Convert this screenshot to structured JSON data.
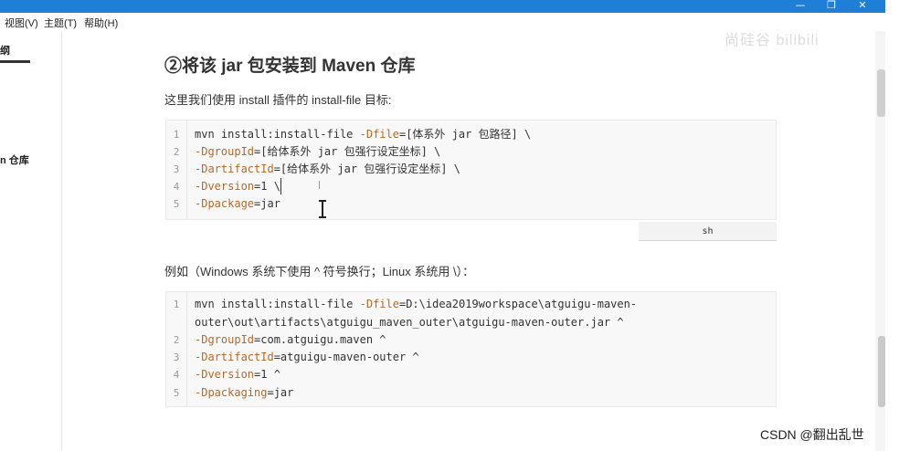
{
  "window": {
    "min_glyph": "—",
    "max_glyph": "❐",
    "close_glyph": "✕"
  },
  "menu": {
    "view": "视图(V)",
    "theme": "主题(T)",
    "help": "帮助(H)"
  },
  "sidebar": {
    "items": [
      {
        "label": "纲"
      },
      {
        "label": "n 仓库"
      }
    ]
  },
  "watermark": "尚硅谷 bilibili",
  "content": {
    "heading": "②将该 jar 包安装到 Maven 仓库",
    "intro": "这里我们使用 install 插件的 install-file 目标:",
    "example_intro": "例如（Windows 系统下使用 ^ 符号换行；Linux 系统用 \\）：",
    "code1": {
      "lang": "sh",
      "lines": [
        {
          "n": "1",
          "cmd": "mvn install:install-file ",
          "param": "-Dfile",
          "rest": "=[体系外 jar 包路径] \\"
        },
        {
          "n": "2",
          "cmd": "",
          "param": "-DgroupId",
          "rest": "=[给体系外 jar 包强行设定坐标] \\"
        },
        {
          "n": "3",
          "cmd": "",
          "param": "-DartifactId",
          "rest": "=[给体系外 jar 包强行设定坐标] \\"
        },
        {
          "n": "4",
          "cmd": "",
          "param": "-Dversion",
          "rest": "=1 \\"
        },
        {
          "n": "5",
          "cmd": "",
          "param": "-Dpackage",
          "rest": "=jar"
        }
      ]
    },
    "code2": {
      "lines": [
        {
          "n": "1",
          "cmd": "mvn install:install-file ",
          "param": "-Dfile",
          "rest": "=D:\\idea2019workspace\\atguigu-maven-"
        },
        {
          "n": "",
          "cmd": "outer\\out\\artifacts\\atguigu_maven_outer\\atguigu-maven-outer.jar ^",
          "param": "",
          "rest": ""
        },
        {
          "n": "2",
          "cmd": "",
          "param": "-DgroupId",
          "rest": "=com.atguigu.maven ^"
        },
        {
          "n": "3",
          "cmd": "",
          "param": "-DartifactId",
          "rest": "=atguigu-maven-outer ^"
        },
        {
          "n": "4",
          "cmd": "",
          "param": "-Dversion",
          "rest": "=1 ^"
        },
        {
          "n": "5",
          "cmd": "",
          "param": "-Dpackaging",
          "rest": "=jar"
        }
      ]
    }
  },
  "credit": "CSDN @翻出乱世",
  "colors": {
    "titlebar": "#1f7fd6",
    "param": "#b06a2c",
    "code_bg": "#f8f8f8"
  }
}
